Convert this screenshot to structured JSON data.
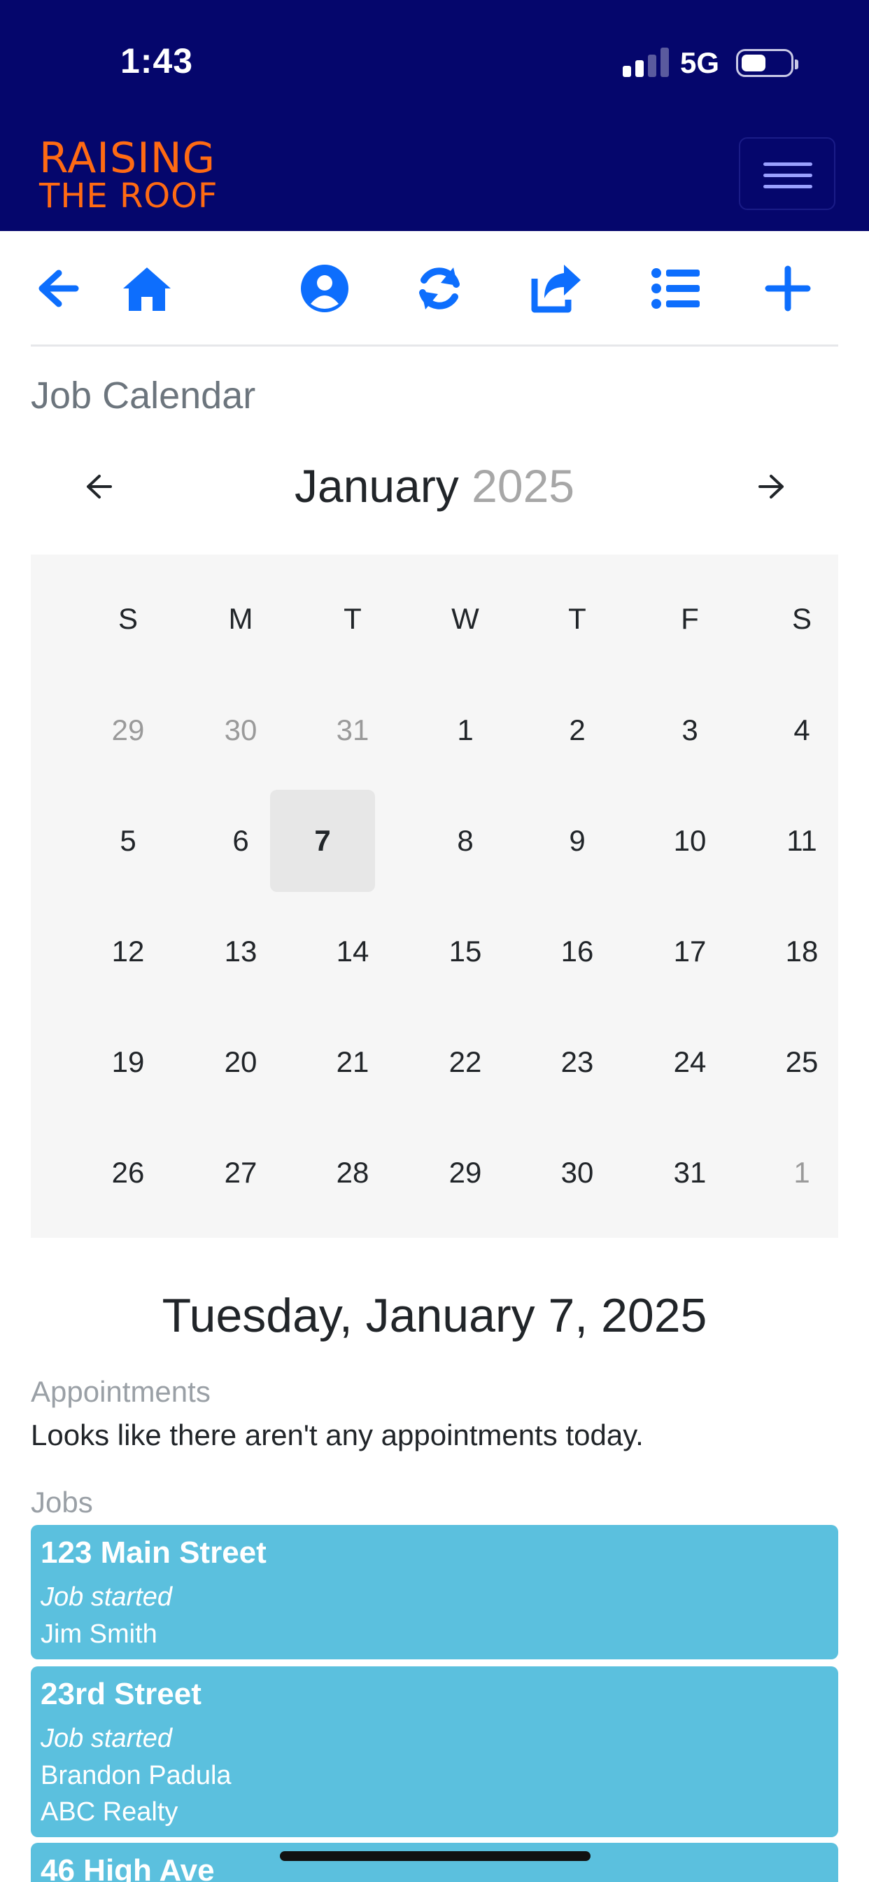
{
  "status_bar": {
    "time": "1:43",
    "network": "5G"
  },
  "brand": {
    "line1": "RAISING",
    "line2": "THE ROOF"
  },
  "toolbar": {
    "icons": [
      "arrow-left-icon",
      "home-icon",
      "user-circle-icon",
      "refresh-icon",
      "share-icon",
      "list-icon",
      "plus-icon"
    ],
    "accent_color": "#0d6efd"
  },
  "page": {
    "title": "Job Calendar"
  },
  "calendar": {
    "month": "January",
    "year": "2025",
    "weekdays": [
      "S",
      "M",
      "T",
      "W",
      "T",
      "F",
      "S"
    ],
    "weeks": [
      [
        "29",
        "30",
        "31",
        "1",
        "2",
        "3",
        "4"
      ],
      [
        "5",
        "6",
        "7",
        "8",
        "9",
        "10",
        "11"
      ],
      [
        "12",
        "13",
        "14",
        "15",
        "16",
        "17",
        "18"
      ],
      [
        "19",
        "20",
        "21",
        "22",
        "23",
        "24",
        "25"
      ],
      [
        "26",
        "27",
        "28",
        "29",
        "30",
        "31",
        "1"
      ]
    ],
    "selected_day": "7"
  },
  "selected": {
    "date_label": "Tuesday, January 7, 2025",
    "appointments_label": "Appointments",
    "appointments_empty": "Looks like there aren't any appointments today.",
    "jobs_label": "Jobs",
    "jobs": [
      {
        "address": "123 Main Street",
        "status": "Job started",
        "lines": [
          "Jim Smith"
        ]
      },
      {
        "address": "23rd Street",
        "status": "Job started",
        "lines": [
          "Brandon Padula",
          "ABC Realty"
        ]
      },
      {
        "address": "46 High Ave",
        "status": "",
        "lines": []
      }
    ]
  },
  "colors": {
    "header_bg": "#05066c",
    "brand_orange": "#ff6a13",
    "job_card_bg": "#5bc0de"
  }
}
